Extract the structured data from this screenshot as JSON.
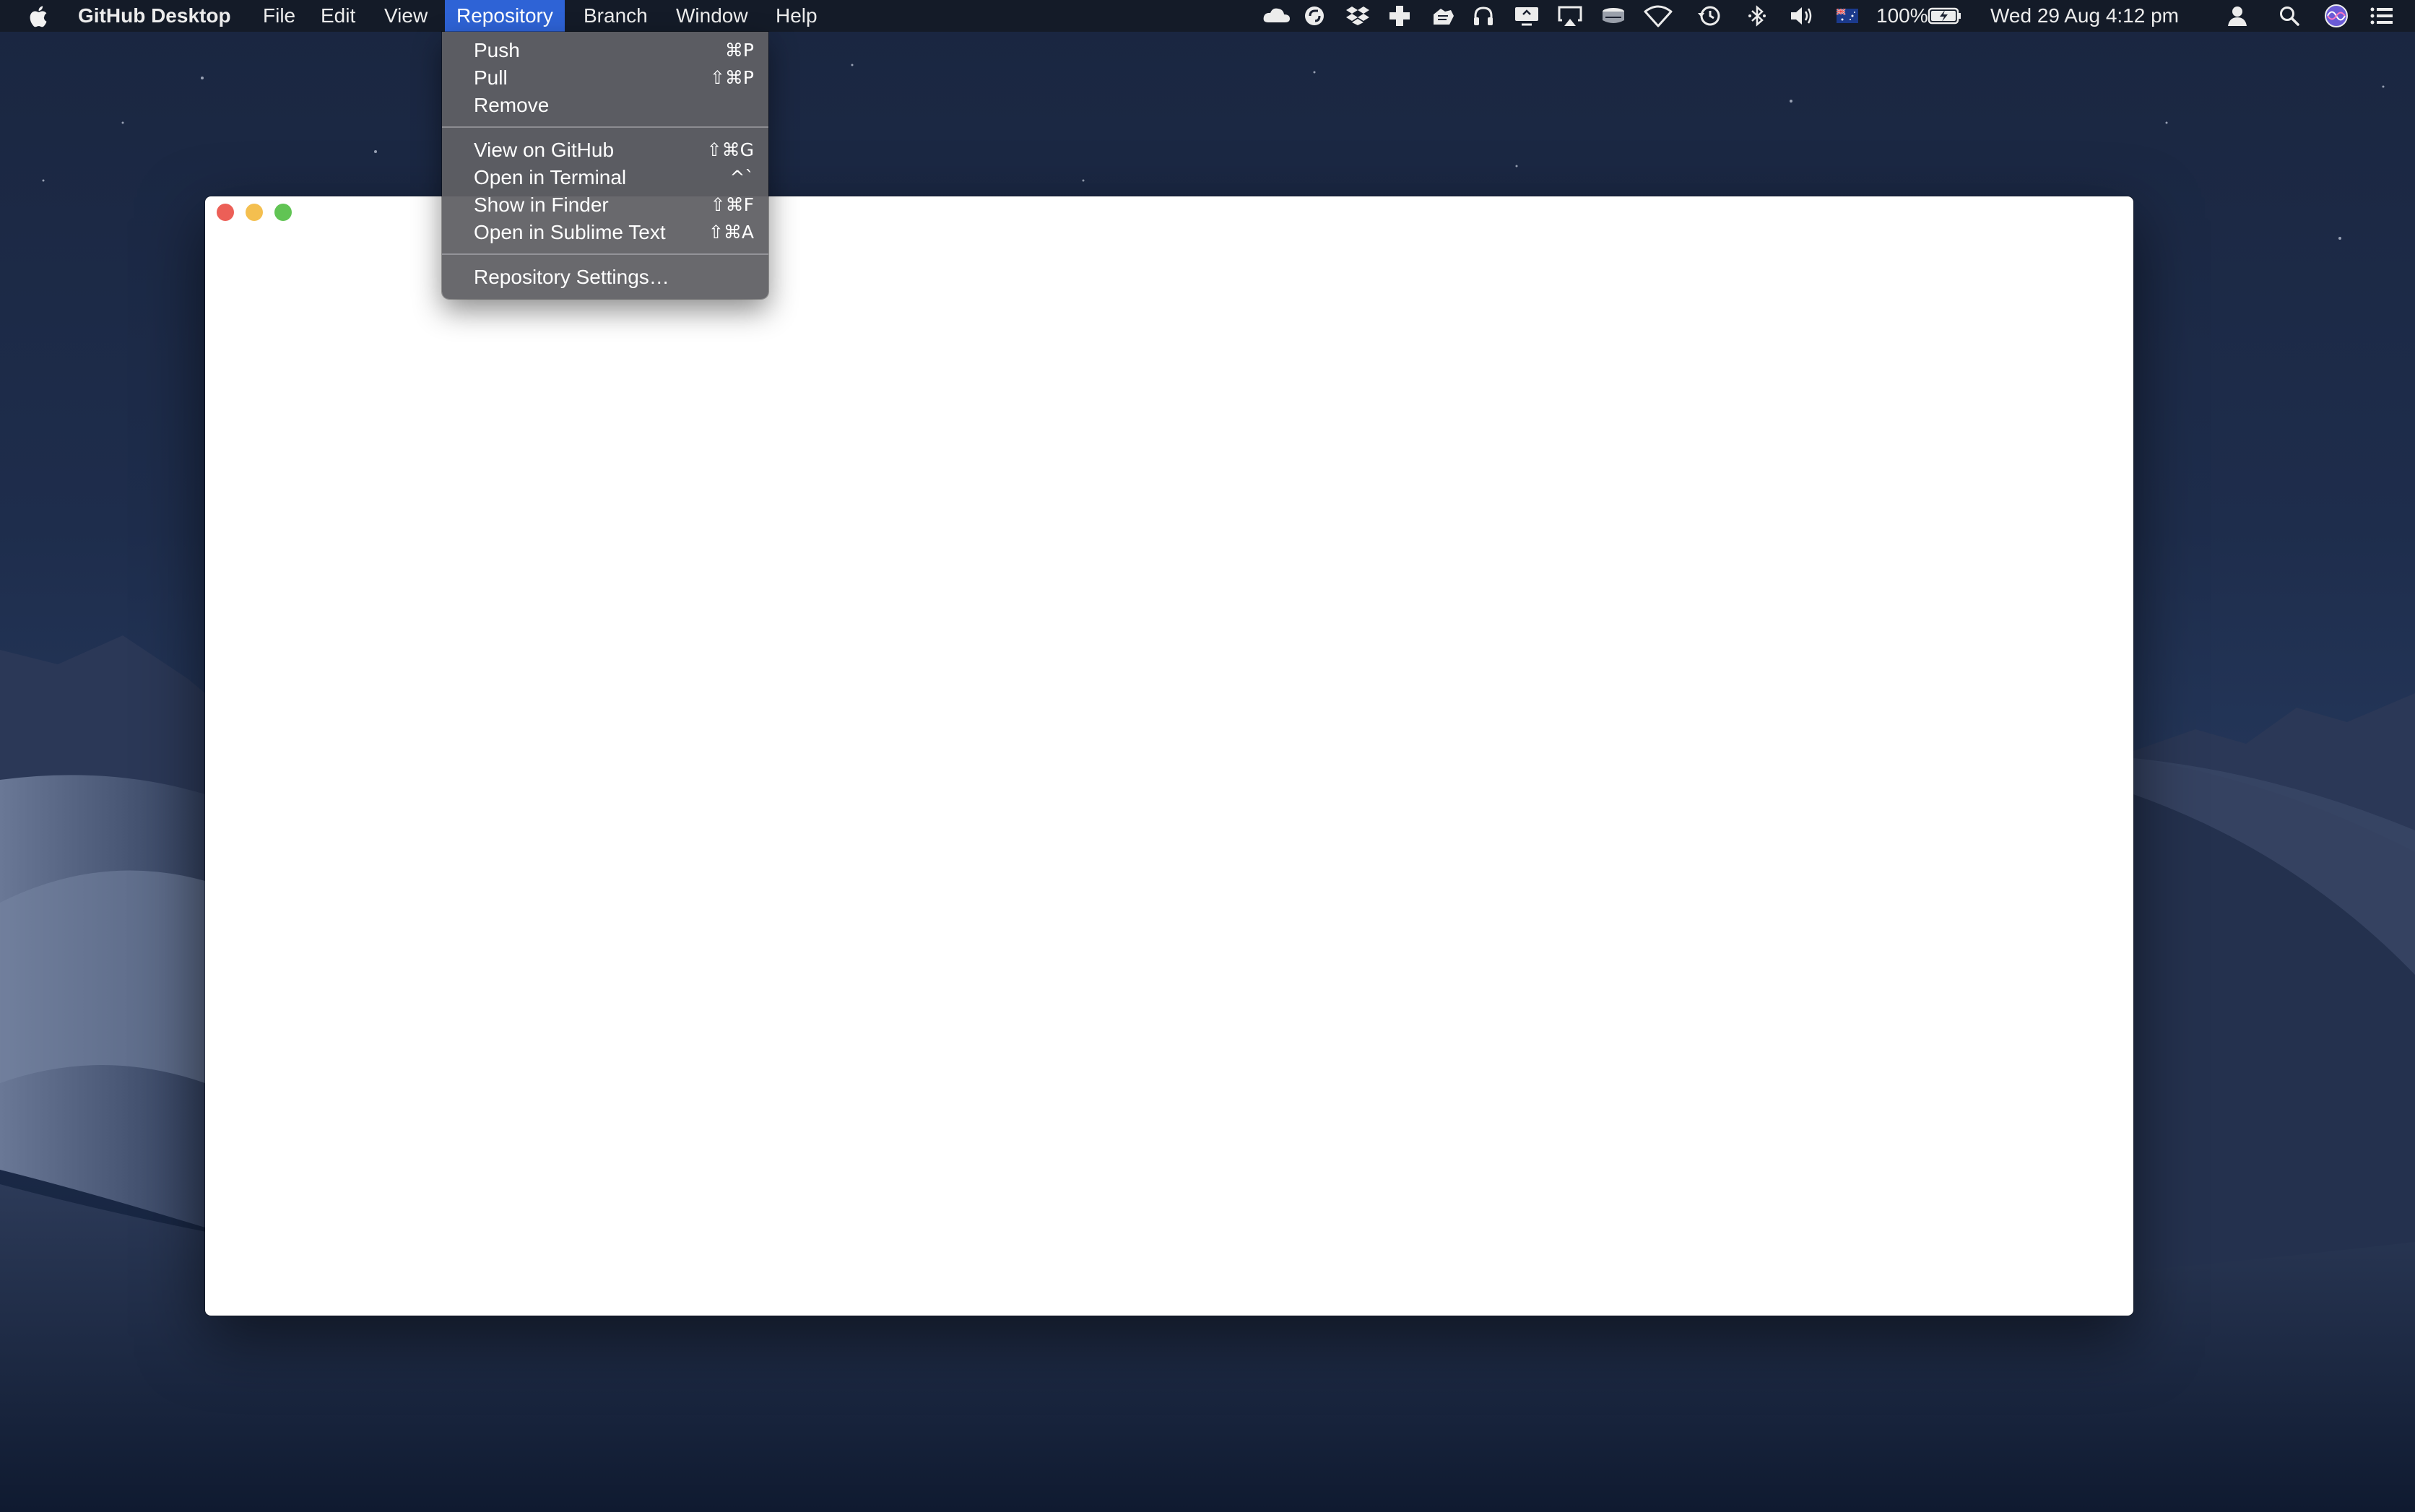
{
  "menubar": {
    "apple_icon": "apple-logo-icon",
    "app_name": "GitHub Desktop",
    "menus": [
      "File",
      "Edit",
      "View",
      "Repository",
      "Branch",
      "Window",
      "Help"
    ],
    "active_menu": "Repository",
    "status_icons": [
      "creative-cloud-icon",
      "sync-icon",
      "dropbox-icon",
      "plus-cross-icon",
      "cloud-app-icon",
      "headphones-icon",
      "screen-share-icon",
      "airplay-icon",
      "drive-icon",
      "wifi-icon",
      "time-machine-icon",
      "bluetooth-icon",
      "volume-icon",
      "flag-icon",
      "battery-icon"
    ],
    "battery_text": "100%",
    "datetime": "Wed 29 Aug  4:12 pm",
    "user_icon": "user-icon",
    "search_icon": "spotlight-search-icon",
    "siri_icon": "siri-icon",
    "notification_icon": "notification-center-icon"
  },
  "repository_menu": {
    "groups": [
      [
        {
          "label": "Push",
          "shortcut": "⌘P"
        },
        {
          "label": "Pull",
          "shortcut": "⇧⌘P"
        },
        {
          "label": "Remove",
          "shortcut": ""
        }
      ],
      [
        {
          "label": "View on GitHub",
          "shortcut": "⇧⌘G"
        },
        {
          "label": "Open in Terminal",
          "shortcut": "^`"
        },
        {
          "label": "Show in Finder",
          "shortcut": "⇧⌘F"
        },
        {
          "label": "Open in Sublime Text",
          "shortcut": "⇧⌘A"
        }
      ],
      [
        {
          "label": "Repository Settings…",
          "shortcut": ""
        }
      ]
    ]
  },
  "window": {
    "traffic_lights": {
      "close": "#ec5f57",
      "minimize": "#f4bf4f",
      "zoom": "#61c454"
    }
  },
  "colors": {
    "menu_highlight": "#2e63d6",
    "menubar_bg": "#141a26",
    "dropdown_bg": "#606064"
  }
}
